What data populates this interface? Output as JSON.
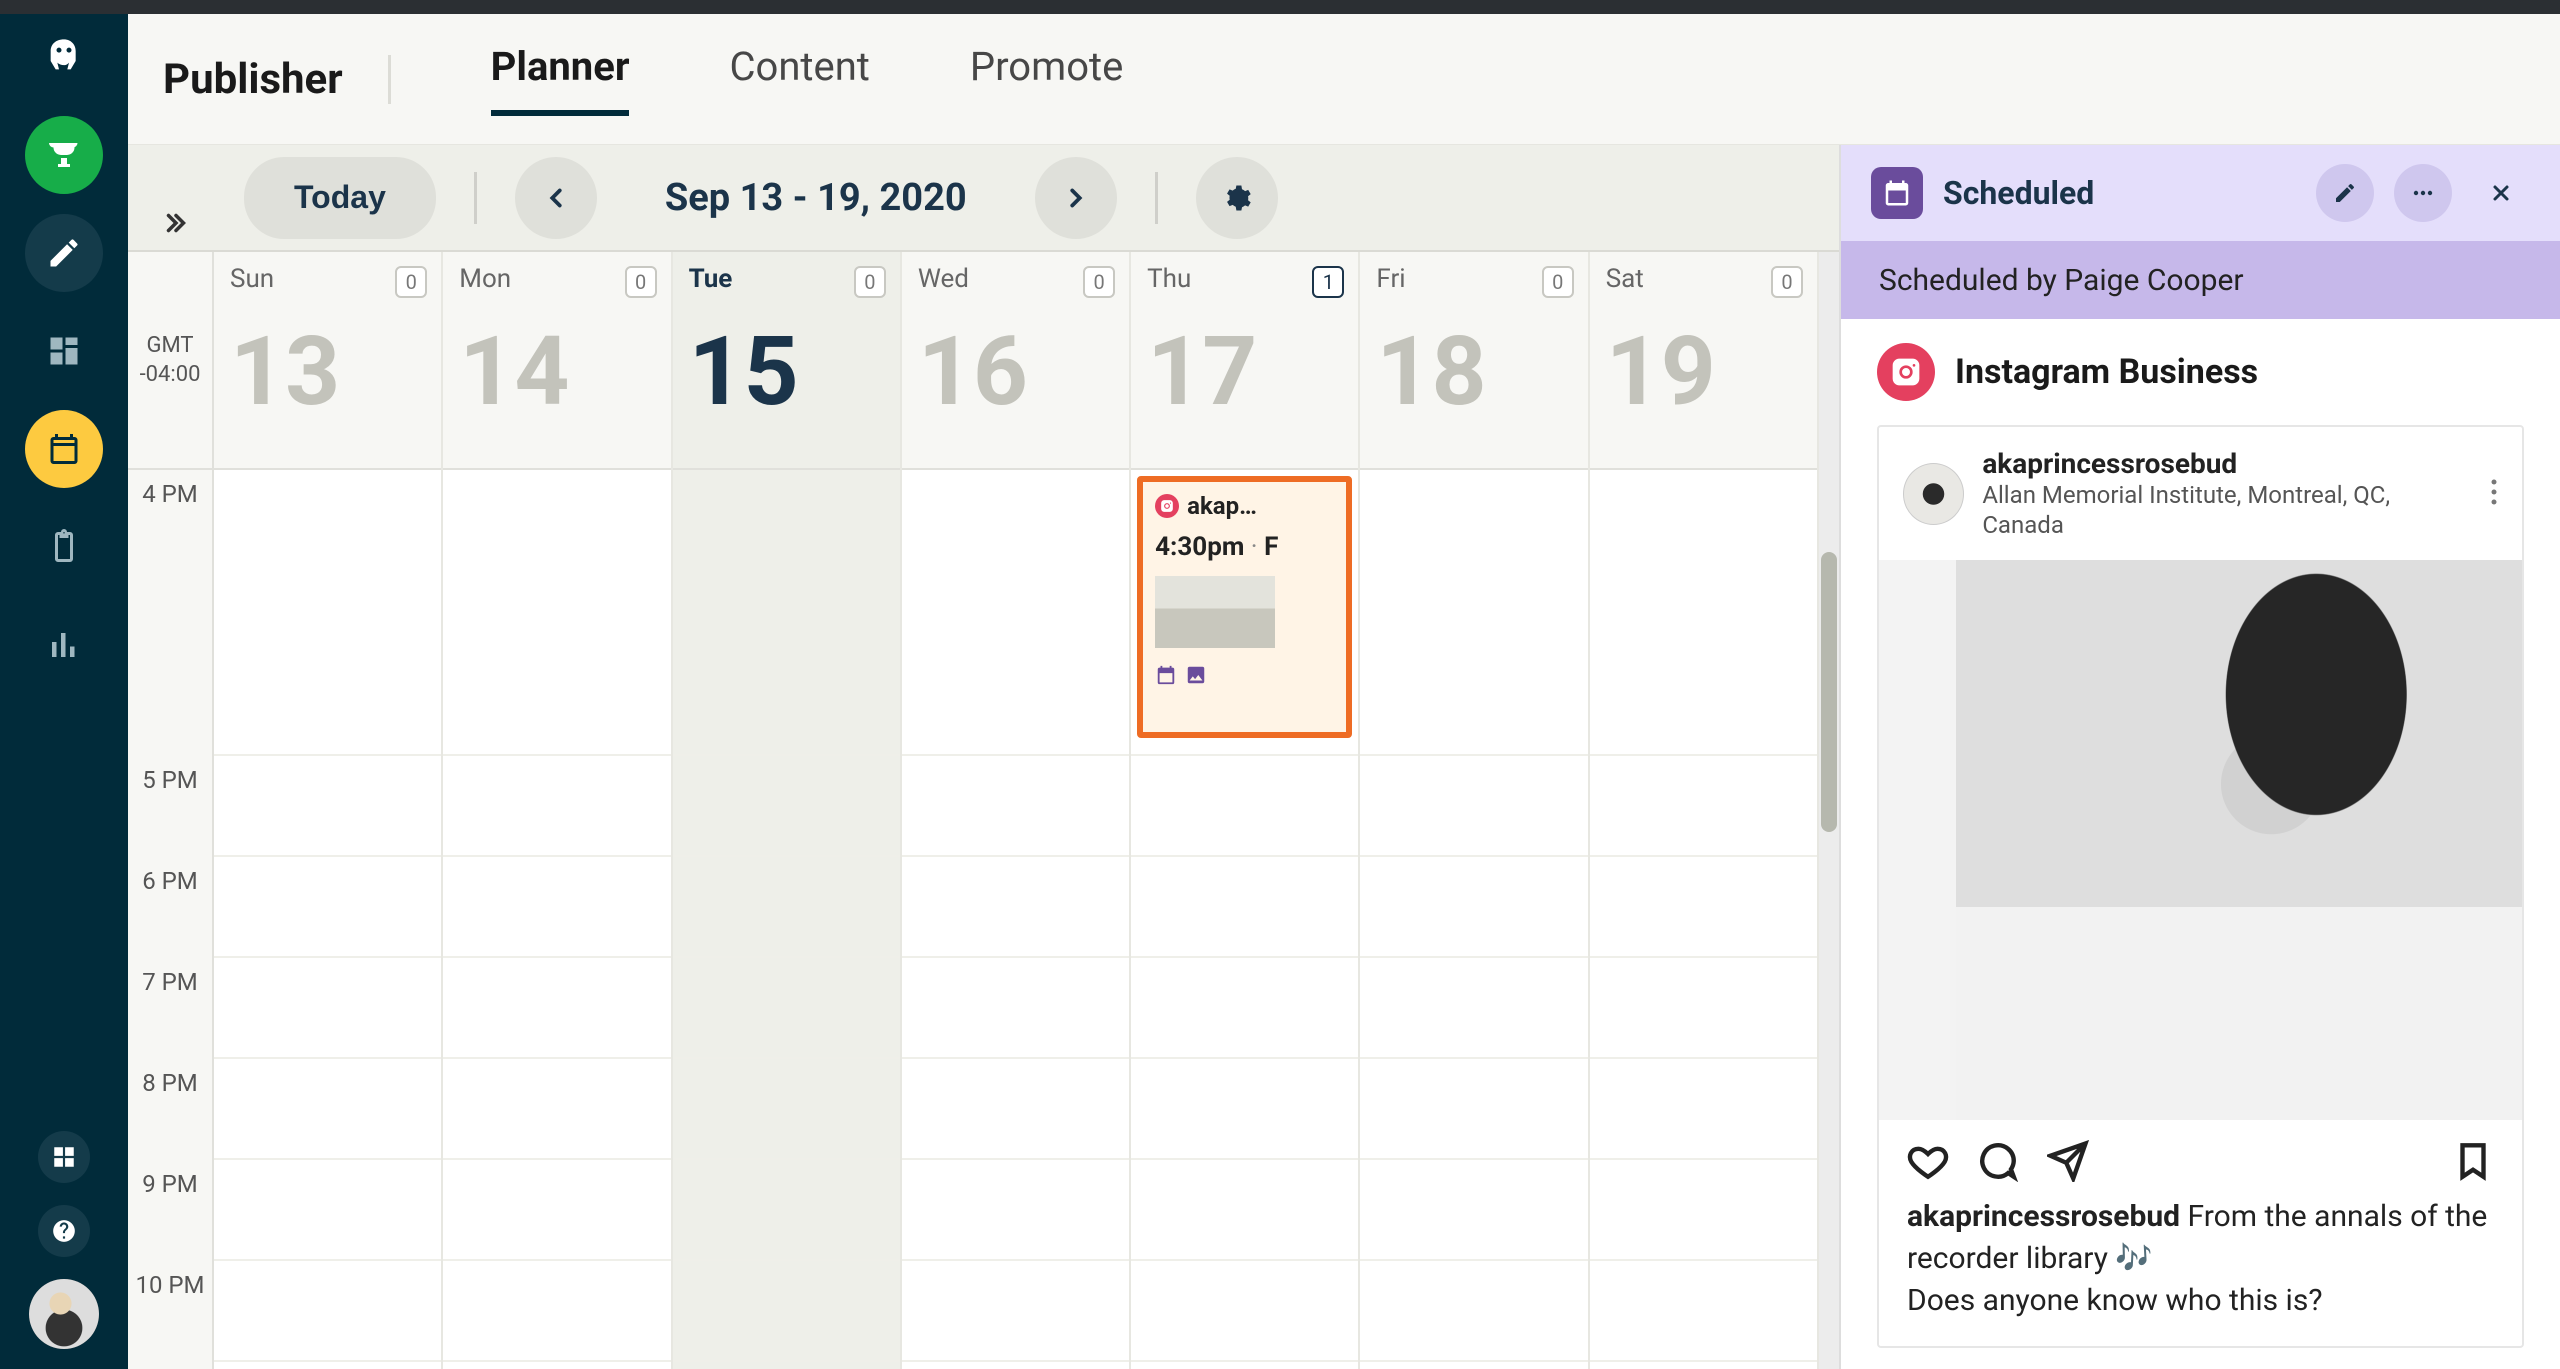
{
  "app_title": "Publisher",
  "tabs": [
    {
      "label": "Planner",
      "active": true
    },
    {
      "label": "Content",
      "active": false
    },
    {
      "label": "Promote",
      "active": false
    }
  ],
  "toolbar": {
    "today_label": "Today",
    "date_range": "Sep 13 - 19, 2020"
  },
  "timezone": {
    "label": "GMT",
    "offset": "-04:00"
  },
  "hours": [
    "4 PM",
    "5 PM",
    "6 PM",
    "7 PM",
    "8 PM",
    "9 PM",
    "10 PM"
  ],
  "days": [
    {
      "name": "Sun",
      "num": "13",
      "count": "0",
      "today": false
    },
    {
      "name": "Mon",
      "num": "14",
      "count": "0",
      "today": false
    },
    {
      "name": "Tue",
      "num": "15",
      "count": "0",
      "today": true
    },
    {
      "name": "Wed",
      "num": "16",
      "count": "0",
      "today": false
    },
    {
      "name": "Thu",
      "num": "17",
      "count": "1",
      "today": false
    },
    {
      "name": "Fri",
      "num": "18",
      "count": "0",
      "today": false
    },
    {
      "name": "Sat",
      "num": "19",
      "count": "0",
      "today": false
    }
  ],
  "event": {
    "account_short": "akap…",
    "time": "4:30pm",
    "sep": " · ",
    "tail": "F"
  },
  "panel": {
    "status": "Scheduled",
    "byline": "Scheduled by Paige Cooper",
    "network": "Instagram Business",
    "post": {
      "username": "akaprincessrosebud",
      "location": "Allan Memorial Institute, Montreal, QC, Canada",
      "caption_user": "akaprincessrosebud",
      "caption_l1": "  From the annals of the recorder library 🎶",
      "caption_l2": "Does anyone know who this is?"
    }
  }
}
